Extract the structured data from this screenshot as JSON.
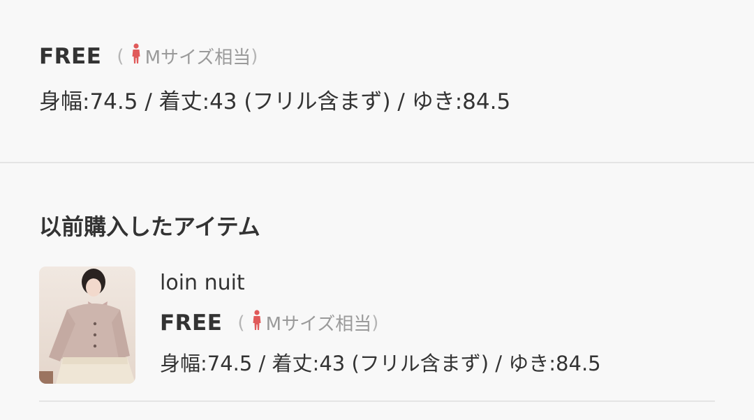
{
  "current_size": {
    "name": "FREE",
    "hint_open": "(",
    "hint_text": "Mサイズ相当",
    "hint_close": ")",
    "measurements": "身幅:74.5 / 着丈:43 (フリル含まず) / ゆき:84.5"
  },
  "purchased_section": {
    "title": "以前購入したアイテム",
    "items": [
      {
        "brand": "loin nuit",
        "size_name": "FREE",
        "hint_open": "(",
        "hint_text": "Mサイズ相当",
        "hint_close": ")",
        "measurements": "身幅:74.5 / 着丈:43 (フリル含まず) / ゆき:84.5"
      }
    ]
  },
  "colors": {
    "background": "#f8f8f8",
    "text": "#333333",
    "hint_text": "#9a9a9a",
    "person_icon": "#e05a5a",
    "divider": "#e4e4e4"
  },
  "icons": {
    "size_hint": "person-icon",
    "item_image": "product-thumbnail"
  }
}
